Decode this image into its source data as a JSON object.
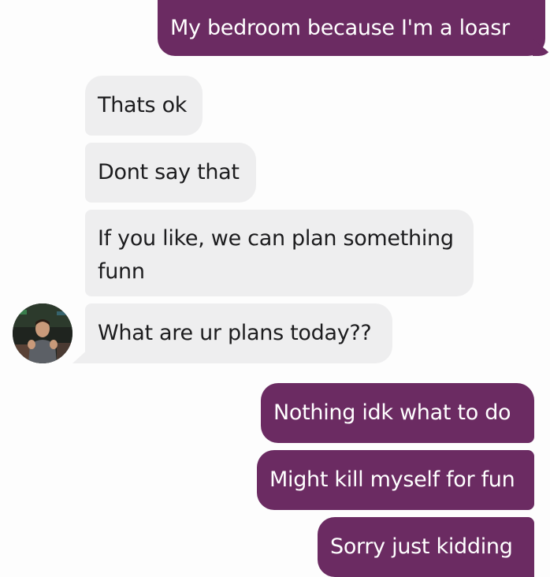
{
  "conversation": {
    "messages": [
      {
        "sender": "me",
        "text": "My bedroom because I'm a loasr"
      },
      {
        "sender": "them",
        "text": "Thats ok"
      },
      {
        "sender": "them",
        "text": "Dont say that"
      },
      {
        "sender": "them",
        "text": "If you like, we can plan something funn"
      },
      {
        "sender": "them",
        "text": "What are ur plans today??"
      },
      {
        "sender": "me",
        "text": "Nothing idk what to do"
      },
      {
        "sender": "me",
        "text": "Might kill myself for fun"
      },
      {
        "sender": "me",
        "text": "Sorry just kidding"
      }
    ]
  },
  "contact": {
    "avatar_icon": "person-photo-avatar"
  },
  "colors": {
    "outgoing_bubble": "#6b2b62",
    "incoming_bubble": "#eeeeef",
    "background": "#fdfdfd"
  }
}
